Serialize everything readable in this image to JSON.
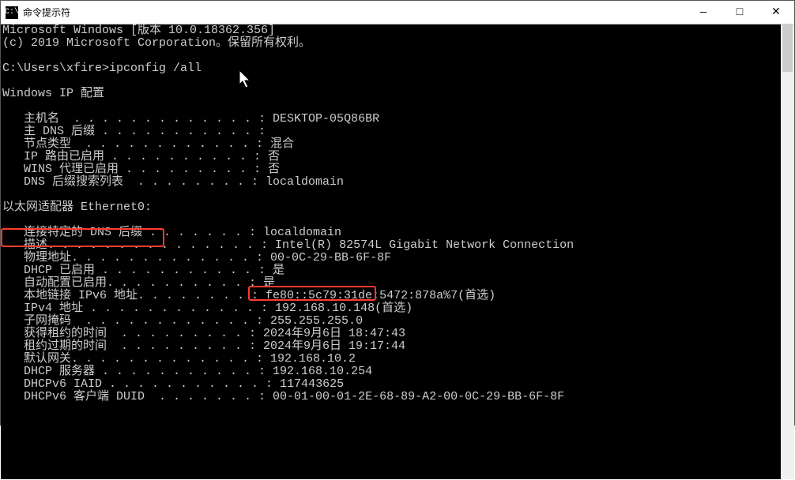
{
  "window": {
    "title": "命令提示符",
    "icon_label": "C:\\",
    "controls": {
      "minimize": "—",
      "maximize": "□",
      "close": "✕"
    }
  },
  "terminal": {
    "lines": [
      "Microsoft Windows [版本 10.0.18362.356]",
      "(c) 2019 Microsoft Corporation。保留所有权利。",
      "",
      "C:\\Users\\xfire>ipconfig /all",
      "",
      "Windows IP 配置",
      "",
      "   主机名  . . . . . . . . . . . . . : DESKTOP-05Q86BR",
      "   主 DNS 后缀 . . . . . . . . . . . :",
      "   节点类型  . . . . . . . . . . . . : 混合",
      "   IP 路由已启用 . . . . . . . . . . : 否",
      "   WINS 代理已启用 . . . . . . . . . : 否",
      "   DNS 后缀搜索列表  . . . . . . . . : localdomain",
      "",
      "以太网适配器 Ethernet0:",
      "",
      "   连接特定的 DNS 后缀 . . . . . . . : localdomain",
      "   描述. . . . . . . . . . . . . . . : Intel(R) 82574L Gigabit Network Connection",
      "   物理地址. . . . . . . . . . . . . : 00-0C-29-BB-6F-8F",
      "   DHCP 已启用 . . . . . . . . . . . : 是",
      "   自动配置已启用. . . . . . . . . . : 是",
      "   本地链接 IPv6 地址. . . . . . . . : fe80::5c79:31de:5472:878a%7(首选)",
      "   IPv4 地址 . . . . . . . . . . . . : 192.168.10.148(首选)",
      "   子网掩码  . . . . . . . . . . . . : 255.255.255.0",
      "   获得租约的时间  . . . . . . . . . : 2024年9月6日 18:47:43",
      "   租约过期的时间  . . . . . . . . . : 2024年9月6日 19:17:44",
      "   默认网关. . . . . . . . . . . . . : 192.168.10.2",
      "   DHCP 服务器 . . . . . . . . . . . : 192.168.10.254",
      "   DHCPv6 IAID . . . . . . . . . . . : 117443625",
      "   DHCPv6 客户端 DUID  . . . . . . . : 00-01-00-01-2E-68-89-A2-00-0C-29-BB-6F-8F"
    ]
  },
  "highlights": {
    "adapter_header": "以太网适配器 Ethernet0:",
    "mac_address": "00-0C-29-BB-6F-8F"
  }
}
